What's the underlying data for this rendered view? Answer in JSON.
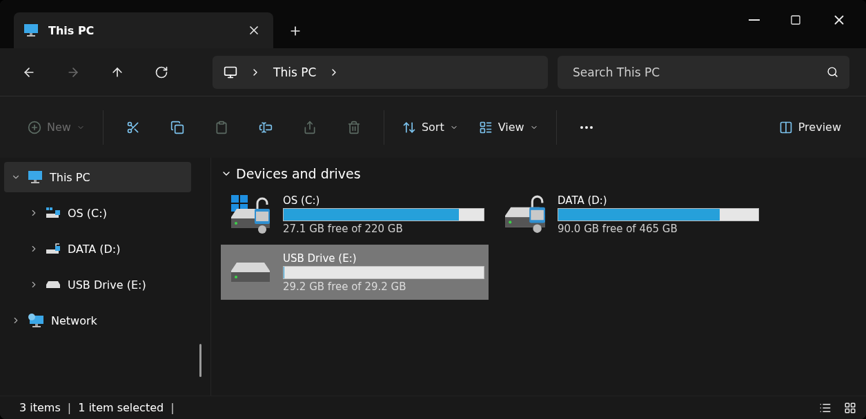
{
  "tab": {
    "title": "This PC",
    "selected": true
  },
  "nav": [
    {
      "kind": "back",
      "disabled": false
    },
    {
      "kind": "forward",
      "disabled": true
    },
    {
      "kind": "up",
      "disabled": false
    },
    {
      "kind": "refresh",
      "disabled": false
    }
  ],
  "address": {
    "crumbs": [
      "This PC"
    ]
  },
  "search": {
    "placeholder": "Search This PC"
  },
  "toolbar": [
    {
      "kind": "new",
      "label": "New",
      "disabled": true
    },
    {
      "kind": "cut",
      "disabled": false
    },
    {
      "kind": "copy",
      "disabled": false
    },
    {
      "kind": "paste",
      "disabled": true
    },
    {
      "kind": "rename",
      "disabled": false
    },
    {
      "kind": "share",
      "disabled": true
    },
    {
      "kind": "delete",
      "disabled": true
    },
    {
      "kind": "sort",
      "label": "Sort",
      "disabled": false
    },
    {
      "kind": "view",
      "label": "View",
      "disabled": false
    },
    {
      "kind": "more",
      "disabled": false
    },
    {
      "kind": "preview",
      "label": "Preview",
      "disabled": false
    }
  ],
  "sidebar": {
    "items": [
      {
        "label": "This PC",
        "kind": "pc",
        "expanded": true,
        "selected": true,
        "children": [
          {
            "label": "OS (C:)",
            "kind": "system",
            "expanded": false,
            "selected": false
          },
          {
            "label": "DATA (D:)",
            "kind": "locked",
            "expanded": false,
            "selected": false
          },
          {
            "label": "USB Drive (E:)",
            "kind": "removable",
            "expanded": false,
            "selected": false
          }
        ]
      },
      {
        "label": "Network",
        "kind": "network",
        "expanded": false,
        "selected": false
      }
    ]
  },
  "content": {
    "group": {
      "title": "Devices and drives",
      "expanded": true
    },
    "drives": [
      {
        "name": "OS (C:)",
        "kind": "system",
        "level": 0.877,
        "free": "27.1 GB free of 220 GB",
        "selected": false
      },
      {
        "name": "DATA (D:)",
        "kind": "locked",
        "level": 0.806,
        "free": "90.0 GB free of 465 GB",
        "selected": false
      },
      {
        "name": "USB Drive (E:)",
        "kind": "removable",
        "level": 0,
        "free": "29.2 GB free of 29.2 GB",
        "selected": true
      }
    ]
  },
  "status_bar": {
    "texts": [
      {
        "kind": "text",
        "text": "3 items"
      },
      {
        "kind": "separator",
        "text": "|"
      },
      {
        "kind": "text",
        "text": "1 item selected"
      },
      {
        "kind": "separator",
        "text": "|"
      }
    ]
  }
}
